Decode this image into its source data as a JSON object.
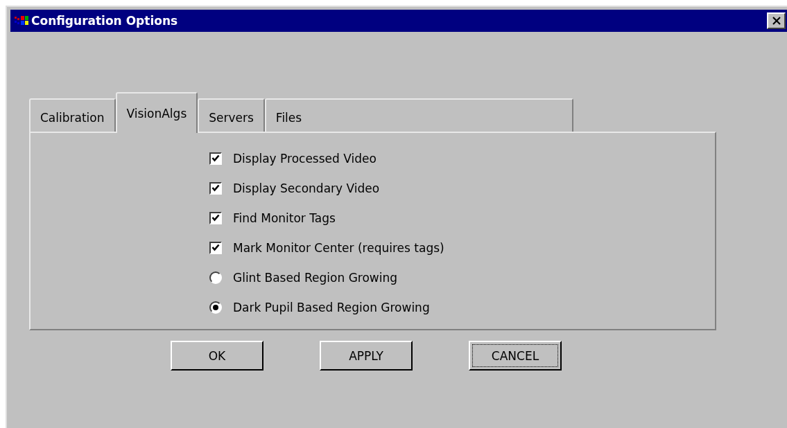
{
  "window": {
    "title": "Configuration Options"
  },
  "tabs": [
    {
      "label": "Calibration",
      "selected": false
    },
    {
      "label": "VisionAlgs",
      "selected": true
    },
    {
      "label": "Servers",
      "selected": false
    },
    {
      "label": "Files",
      "selected": false
    }
  ],
  "options": [
    {
      "kind": "checkbox",
      "label": "Display Processed Video",
      "checked": true
    },
    {
      "kind": "checkbox",
      "label": "Display Secondary Video",
      "checked": true
    },
    {
      "kind": "checkbox",
      "label": "Find Monitor Tags",
      "checked": true
    },
    {
      "kind": "checkbox",
      "label": "Mark Monitor Center (requires tags)",
      "checked": true
    },
    {
      "kind": "radio",
      "label": "Glint Based Region Growing",
      "selected": false
    },
    {
      "kind": "radio",
      "label": "Dark Pupil Based Region Growing",
      "selected": true
    }
  ],
  "buttons": [
    {
      "label": "OK",
      "focused": false
    },
    {
      "label": "APPLY",
      "focused": false
    },
    {
      "label": "CANCEL",
      "focused": true
    }
  ]
}
